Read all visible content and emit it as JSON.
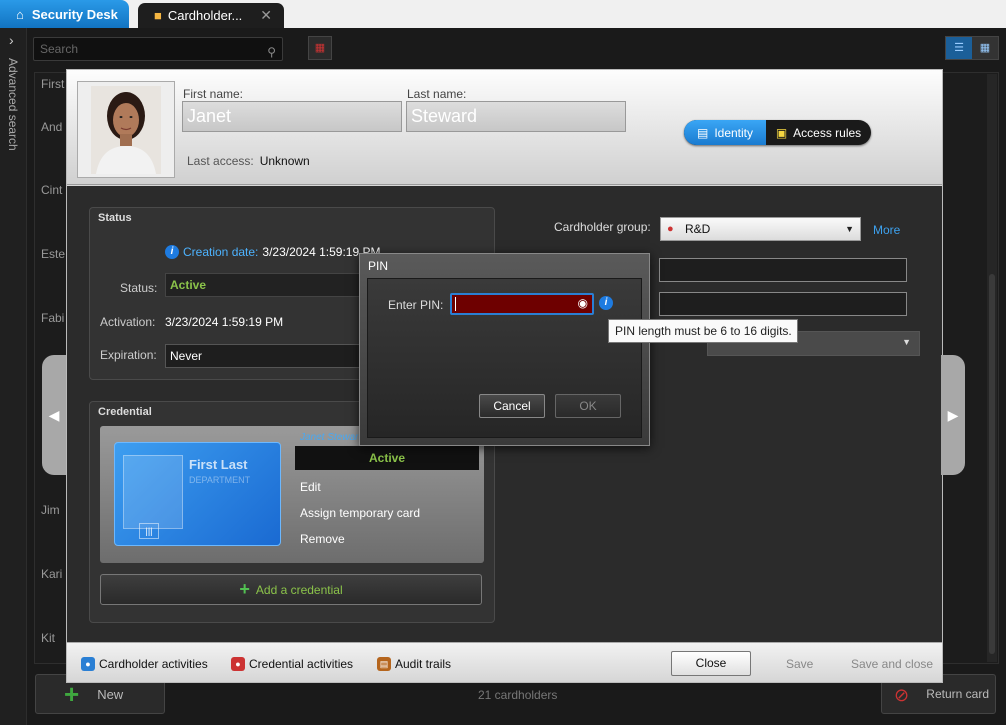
{
  "tabs": {
    "home_label": "Security Desk",
    "active_label": "Cardholder..."
  },
  "sidebar": {
    "label": "Advanced search"
  },
  "search": {
    "placeholder": "Search"
  },
  "list": {
    "rows": [
      "First",
      "And",
      "Cint",
      "Este",
      "Fabi",
      "Jim",
      "Kari",
      "Kit"
    ]
  },
  "bottom": {
    "new_label": "New",
    "count": "21 cardholders",
    "return_label": "Return card"
  },
  "identity": {
    "first_name_label": "First name:",
    "first_name": "Janet",
    "last_name_label": "Last name:",
    "last_name": "Steward",
    "last_access_label": "Last access:",
    "last_access": "Unknown"
  },
  "segment": {
    "identity": "Identity",
    "access_rules": "Access rules"
  },
  "status_panel": {
    "title": "Status",
    "creation_label": "Creation date:",
    "creation_value": "3/23/2024 1:59:19 PM",
    "status_label": "Status:",
    "status_value": "Active",
    "activation_label": "Activation:",
    "activation_value": "3/23/2024 1:59:19 PM",
    "expiration_label": "Expiration:",
    "expiration_value": "Never"
  },
  "credential_panel": {
    "title": "Credential",
    "owner": "Janet Steward",
    "card_name": "First Last",
    "card_dept": "DEPARTMENT",
    "status": "Active",
    "edit": "Edit",
    "assign_temp": "Assign temporary card",
    "remove": "Remove",
    "add": "Add a credential"
  },
  "right": {
    "group_label": "Cardholder group:",
    "group_value": "R&D",
    "more": "More"
  },
  "footer": {
    "cardholder_activities": "Cardholder activities",
    "credential_activities": "Credential activities",
    "audit_trails": "Audit trails",
    "close": "Close",
    "save": "Save",
    "save_close": "Save and close"
  },
  "pin_dialog": {
    "title": "PIN",
    "enter_label": "Enter PIN:",
    "tooltip": "PIN length must be 6 to 16 digits.",
    "cancel": "Cancel",
    "ok": "OK"
  },
  "colors": {
    "accent": "#1a7bd0",
    "active_green": "#8bc34a",
    "pin_error": "#6e0000"
  },
  "icons": [
    "home-icon",
    "cardholder-icon",
    "close-icon",
    "search-icon",
    "info-icon",
    "eye-icon",
    "plus-icon",
    "identity-icon",
    "access-rules-icon",
    "chevron-left-icon",
    "chevron-right-icon"
  ]
}
